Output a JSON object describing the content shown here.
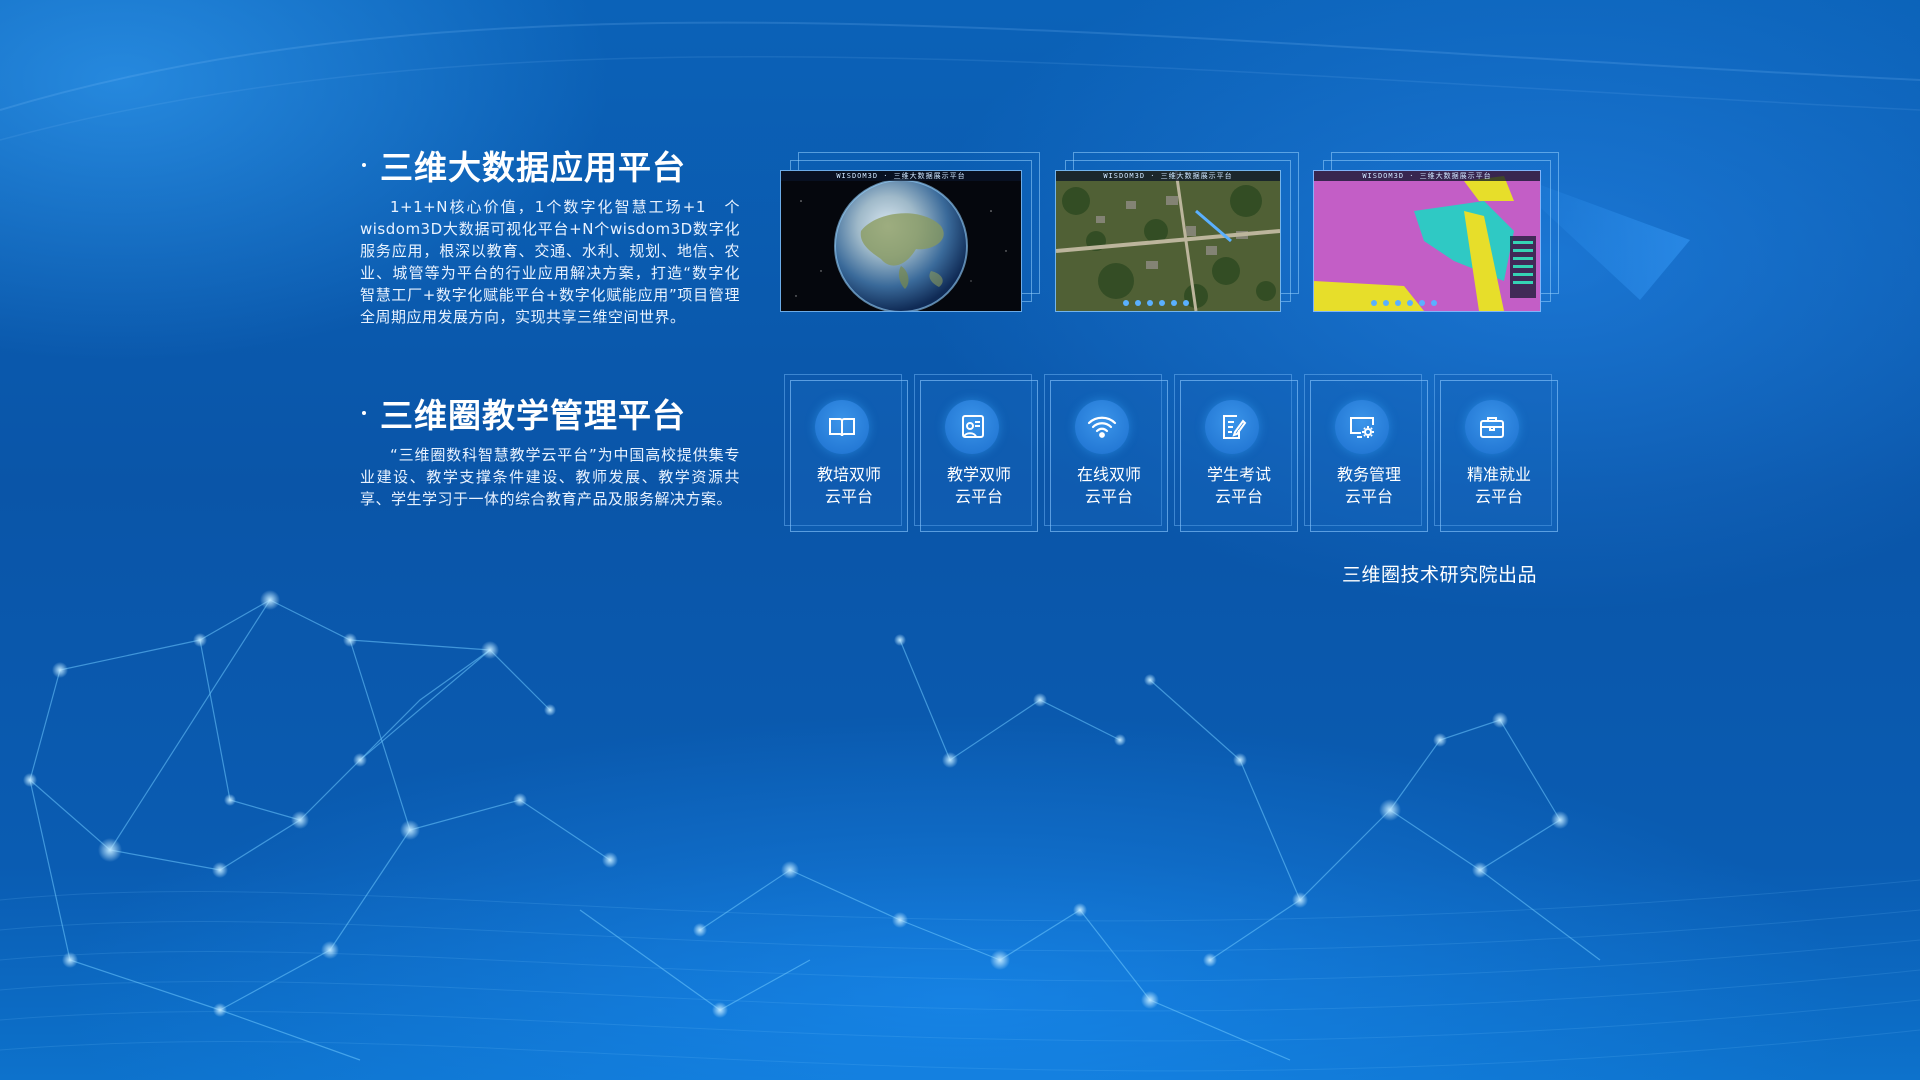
{
  "section1": {
    "title": "三维大数据应用平台",
    "description": "1+1+N核心价值，1个数字化智慧工场+1　个wisdom3D大数据可视化平台+N个wisdom3D数字化服务应用，根深以教育、交通、水利、规划、地信、农业、城管等为平台的行业应用解决方案，打造“数字化智慧工厂+数字化赋能平台+数字化赋能应用”项目管理全周期应用发展方向，实现共享三维空间世界。"
  },
  "section2": {
    "title": "三维圈教学管理平台",
    "description": "“三维圈数科智慧教学云平台”为中国高校提供集专业建设、教学支撑条件建设、教师发展、教学资源共享、学生学习于一体的综合教育产品及服务解决方案。"
  },
  "screenshots": [
    {
      "caption": "WISDOM3D · 三维大数据展示平台",
      "icon": "globe-earth-image"
    },
    {
      "caption": "WISDOM3D · 三维大数据展示平台",
      "icon": "aerial-village-image"
    },
    {
      "caption": "WISDOM3D · 三维大数据展示平台",
      "icon": "land-use-map-image"
    }
  ],
  "platforms": [
    {
      "line1": "教培双师",
      "line2": "云平台",
      "icon": "book-icon"
    },
    {
      "line1": "教学双师",
      "line2": "云平台",
      "icon": "teacher-board-icon"
    },
    {
      "line1": "在线双师",
      "line2": "云平台",
      "icon": "wifi-icon"
    },
    {
      "line1": "学生考试",
      "line2": "云平台",
      "icon": "exam-edit-icon"
    },
    {
      "line1": "教务管理",
      "line2": "云平台",
      "icon": "monitor-gear-icon"
    },
    {
      "line1": "精准就业",
      "line2": "云平台",
      "icon": "briefcase-icon"
    }
  ],
  "footer": {
    "credit": "三维圈技术研究院出品"
  },
  "colors": {
    "background": "#0a57aa",
    "accent": "#2a86e0",
    "line": "#5ac0ff"
  }
}
